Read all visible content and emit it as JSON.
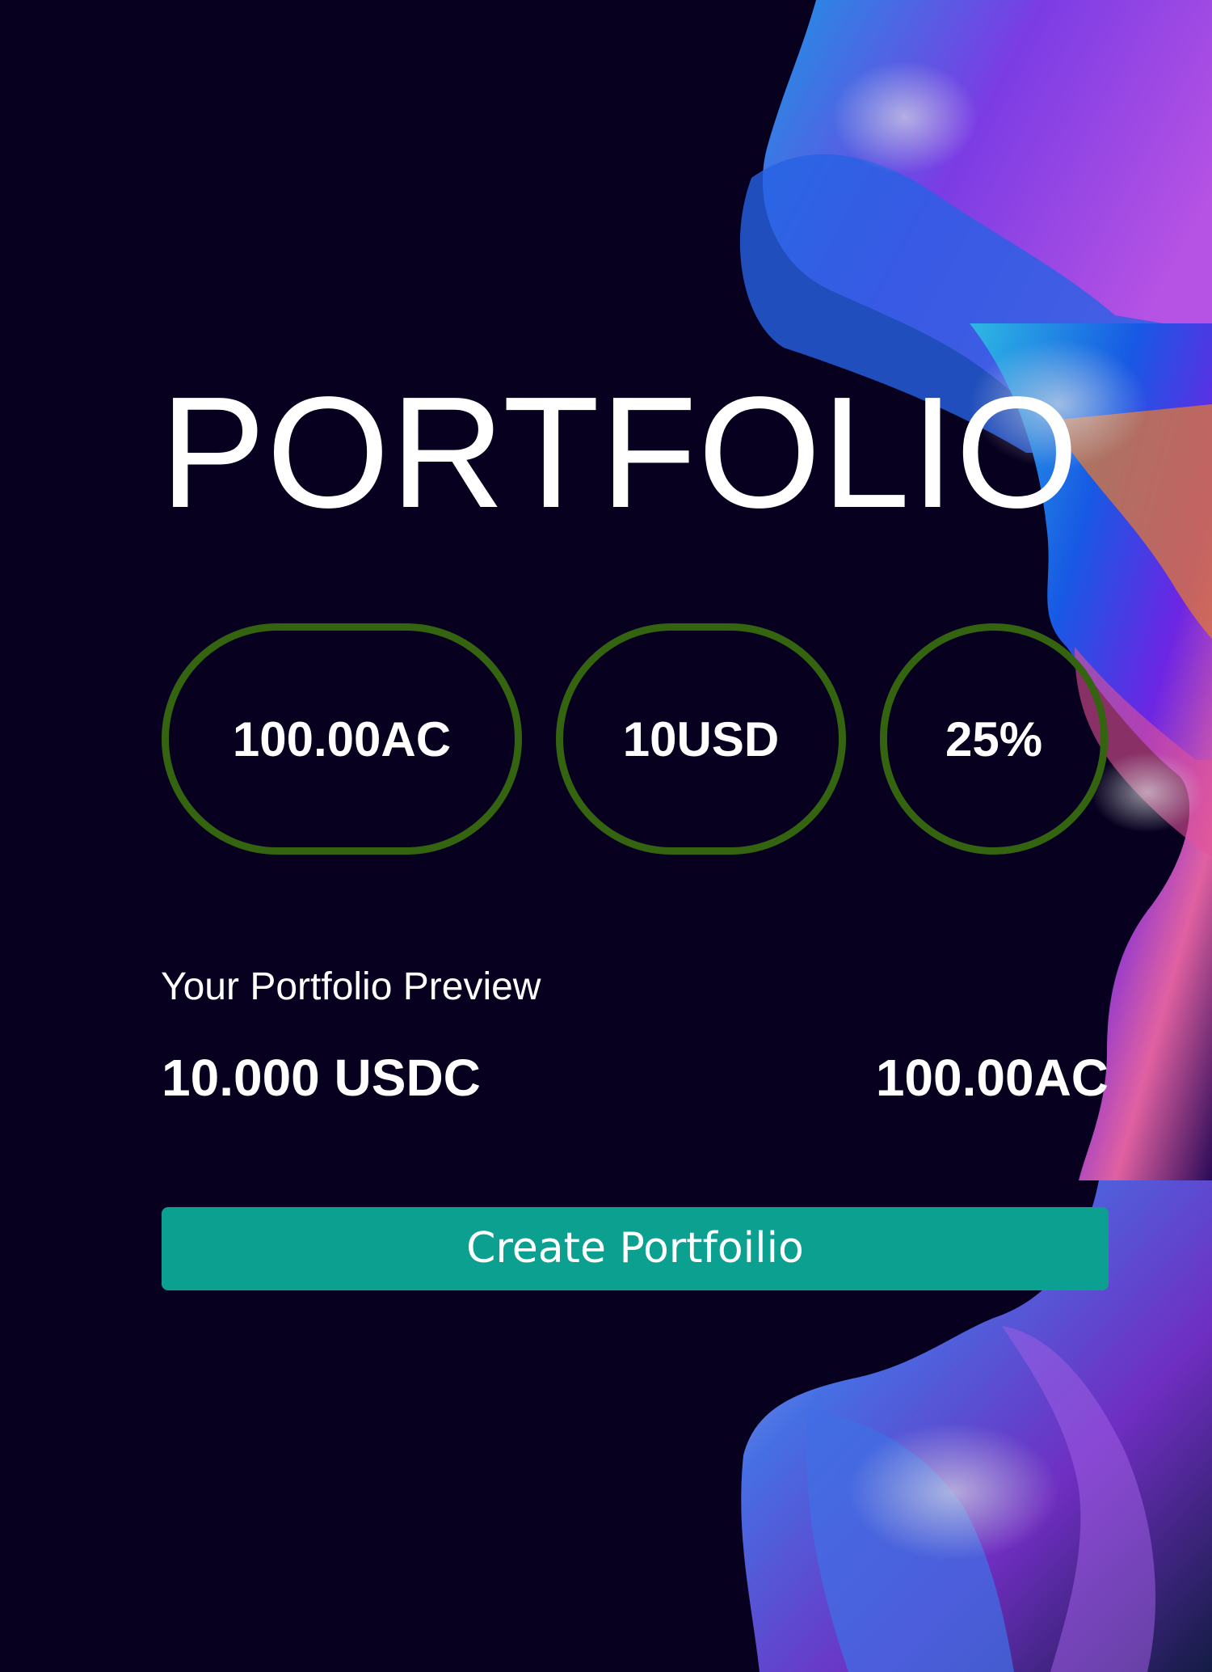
{
  "page": {
    "title": "PORTFOLIO"
  },
  "stats": [
    {
      "label": "100.00AC"
    },
    {
      "label": "10USD"
    },
    {
      "label": "25%"
    }
  ],
  "preview": {
    "label": "Your Portfolio Preview",
    "left_value": "10.000 USDC",
    "right_value": "100.00AC"
  },
  "actions": {
    "create_label": "Create Portfoilio"
  },
  "colors": {
    "background": "#07011f",
    "pill_border": "#34640f",
    "button": "#0ca091",
    "text": "#ffffff"
  }
}
